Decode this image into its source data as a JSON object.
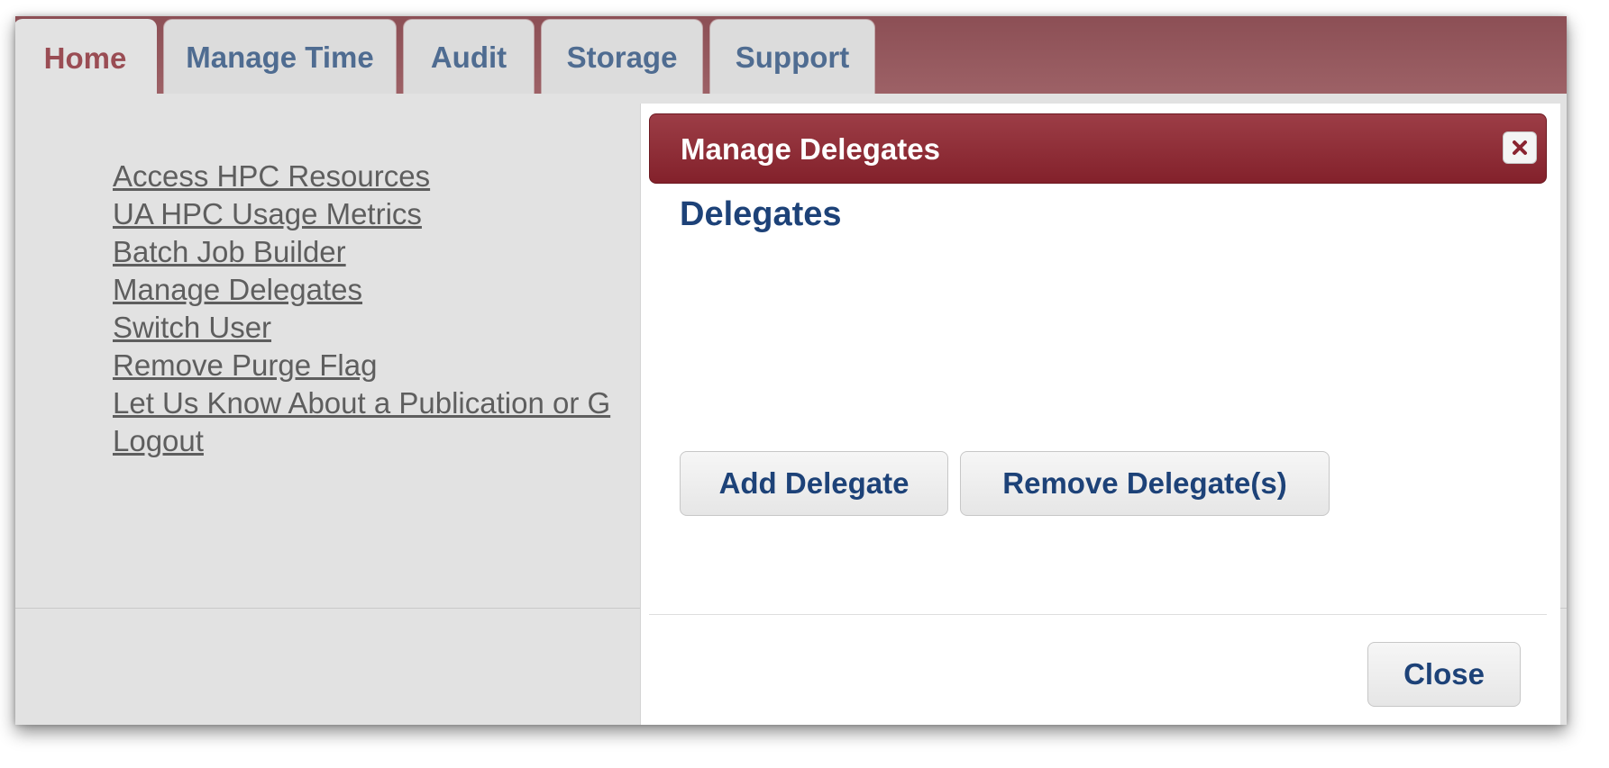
{
  "tabs": [
    {
      "label": "Home",
      "active": true
    },
    {
      "label": "Manage Time",
      "active": false
    },
    {
      "label": "Audit",
      "active": false
    },
    {
      "label": "Storage",
      "active": false
    },
    {
      "label": "Support",
      "active": false
    }
  ],
  "links": [
    "Access HPC Resources",
    "UA HPC Usage Metrics",
    "Batch Job Builder",
    "Manage Delegates",
    "Switch User",
    "Remove Purge Flag",
    "Let Us Know About a Publication or G",
    "Logout"
  ],
  "dialog": {
    "title": "Manage Delegates",
    "heading": "Delegates",
    "add_button": "Add Delegate",
    "remove_button": "Remove Delegate(s)",
    "close_button": "Close",
    "close_icon": "close-x-icon"
  },
  "colors": {
    "tabbar_bg": "#8c4f55",
    "active_tab_text": "#9a4d54",
    "tab_text": "#4f6c91",
    "dialog_header": "#83212b",
    "heading_text": "#1d4278"
  }
}
